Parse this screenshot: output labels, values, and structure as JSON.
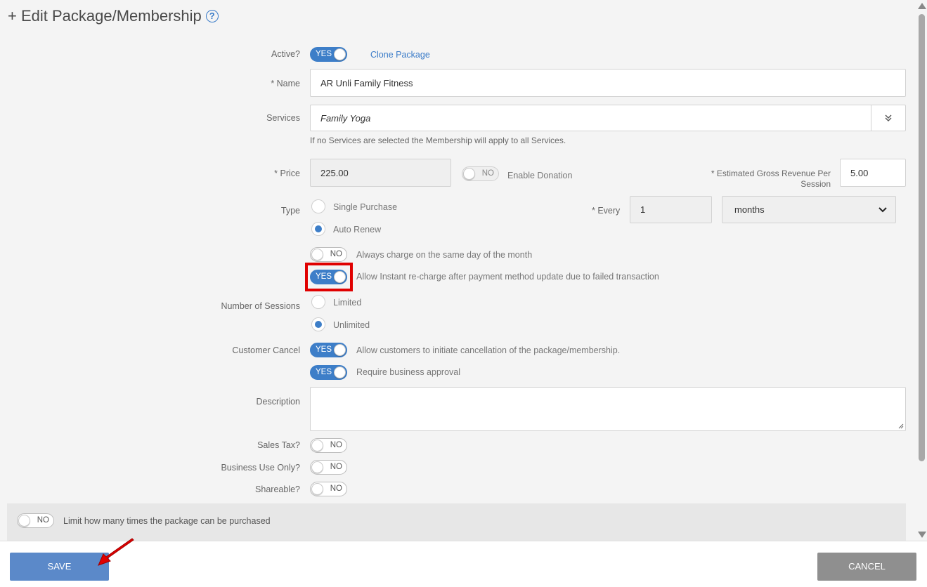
{
  "header": {
    "title": "+ Edit Package/Membership",
    "help_icon": "question-circle-icon"
  },
  "active": {
    "label": "Active?",
    "toggle": "YES",
    "clone_link": "Clone Package"
  },
  "name": {
    "label": "* Name",
    "value": "AR Unli Family Fitness"
  },
  "services": {
    "label": "Services",
    "value": "Family Yoga",
    "hint": "If no Services are selected the Membership will apply to all Services."
  },
  "price": {
    "label": "* Price",
    "value": "225.00",
    "donation_toggle": "NO",
    "donation_label": "Enable Donation",
    "revenue_label_line1": "* Estimated Gross Revenue Per",
    "revenue_label_line2": "Session",
    "revenue_value": "5.00"
  },
  "type": {
    "label": "Type",
    "options": [
      "Single Purchase",
      "Auto Renew"
    ],
    "selected": "Auto Renew",
    "every_label": "* Every",
    "every_value": "1",
    "period": "months"
  },
  "charge_same_day": {
    "toggle": "NO",
    "label": "Always charge on the same day of the month"
  },
  "instant_recharge": {
    "toggle": "YES",
    "label": "Allow Instant re-charge after payment method update due to failed transaction"
  },
  "sessions": {
    "label": "Number of Sessions",
    "options": [
      "Limited",
      "Unlimited"
    ],
    "selected": "Unlimited"
  },
  "customer_cancel": {
    "label": "Customer Cancel",
    "toggle": "YES",
    "text": "Allow customers to initiate cancellation of the package/membership.",
    "approval_toggle": "YES",
    "approval_text": "Require business approval"
  },
  "description": {
    "label": "Description",
    "value": ""
  },
  "sales_tax": {
    "label": "Sales Tax?",
    "toggle": "NO"
  },
  "business_use": {
    "label": "Business Use Only?",
    "toggle": "NO"
  },
  "shareable": {
    "label": "Shareable?",
    "toggle": "NO"
  },
  "limit": {
    "toggle": "NO",
    "label": "Limit how many times the package can be purchased"
  },
  "footer": {
    "save": "SAVE",
    "cancel": "CANCEL"
  },
  "colors": {
    "accent": "#3d7ec8",
    "highlight": "#e00000",
    "save_button": "#5b89c9",
    "cancel_button": "#8f8f8f"
  }
}
